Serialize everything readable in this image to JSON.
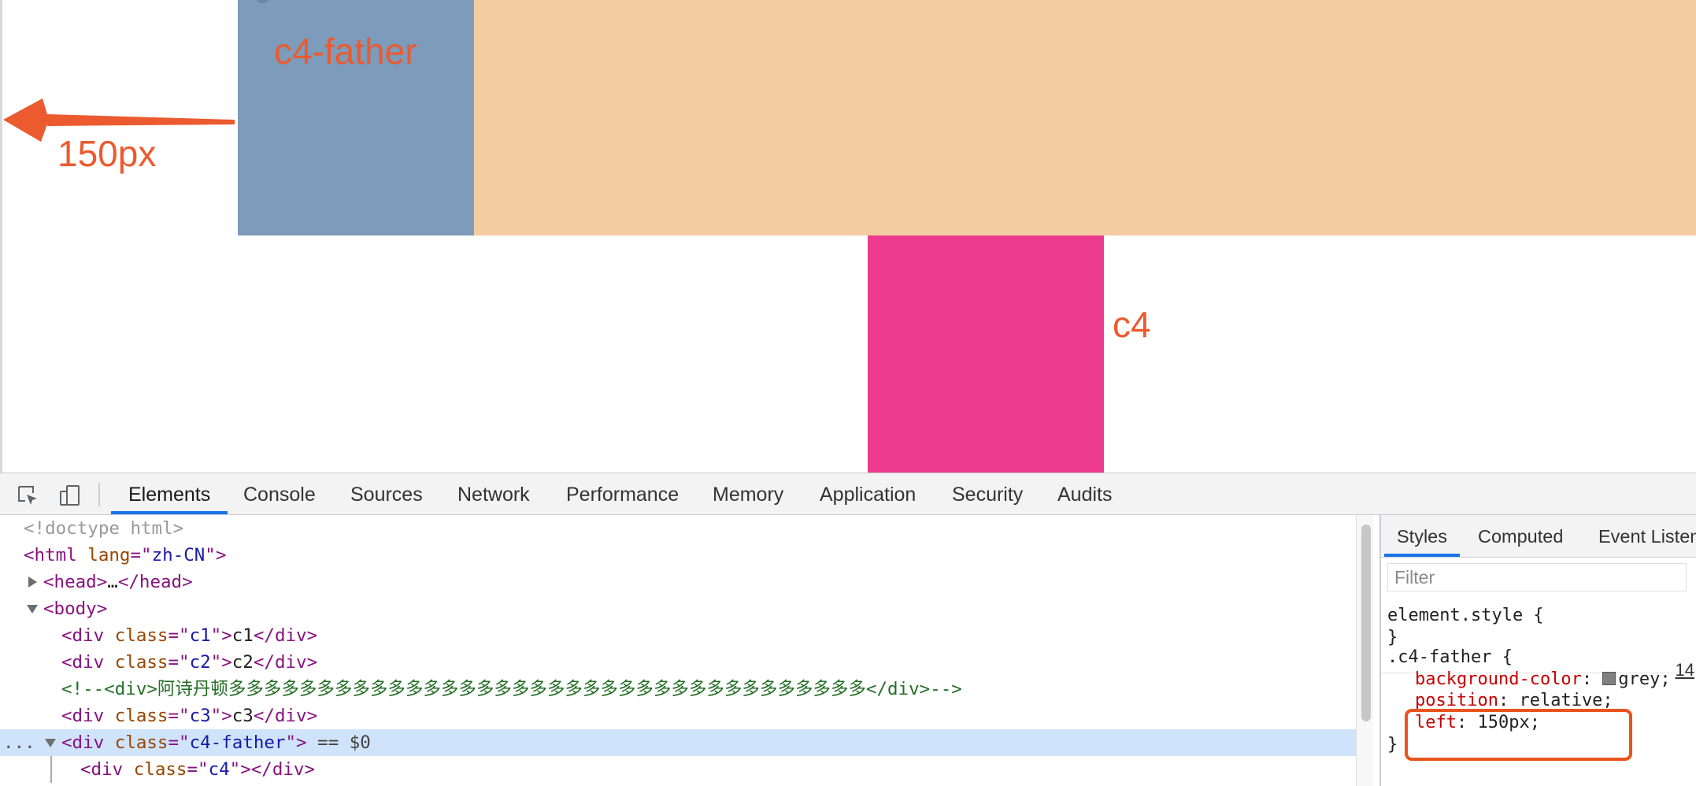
{
  "page": {
    "annotations": {
      "father_label": "c4-father",
      "offset_label": "150px",
      "child_label": "c4"
    }
  },
  "devtools": {
    "tabs": [
      "Elements",
      "Console",
      "Sources",
      "Network",
      "Performance",
      "Memory",
      "Application",
      "Security",
      "Audits"
    ],
    "active_tab": "Elements",
    "dom": {
      "doctype": "<!doctype html>",
      "html_open": {
        "tag": "html",
        "attr": "lang",
        "val": "zh-CN"
      },
      "head_tag": "head",
      "head_collapsed": "…",
      "body_tag": "body",
      "div_tag": "div",
      "class_attr": "class",
      "c1": {
        "val": "c1",
        "text": "c1"
      },
      "c2": {
        "val": "c2",
        "text": "c2"
      },
      "comment": "<!--<div>阿诗丹顿多多多多多多多多多多多多多多多多多多多多多多多多多多多多多多多多多多多多</div>-->",
      "c3": {
        "val": "c3",
        "text": "c3"
      },
      "c4_father": {
        "val": "c4-father",
        "suffix": " == $0",
        "ellipsis": "..."
      },
      "c4": {
        "val": "c4"
      }
    },
    "styles": {
      "tabs": [
        "Styles",
        "Computed",
        "Event Listeners"
      ],
      "active_tab": "Styles",
      "filter_placeholder": "Filter",
      "element_style_open": "element.style {",
      "close_brace": "}",
      "rule_selector": ".c4-father {",
      "source_ref": "14",
      "declarations": [
        {
          "prop": "background-color",
          "value": "grey;",
          "swatch": "#808080"
        },
        {
          "prop": "position",
          "value": "relative;"
        },
        {
          "prop": "left",
          "value": "150px;"
        }
      ]
    }
  },
  "colors": {
    "father_box": "#7d9bba",
    "tan_box": "#f4cca2",
    "c4_box": "#ec3b8f",
    "annotation": "#ec5a2f",
    "tab_accent": "#1a73e8",
    "selection": "#cfe3fa"
  },
  "icons": {
    "inspect": "inspect-element-icon",
    "device": "device-toggle-icon",
    "arrow": "left-arrow-annotation"
  }
}
